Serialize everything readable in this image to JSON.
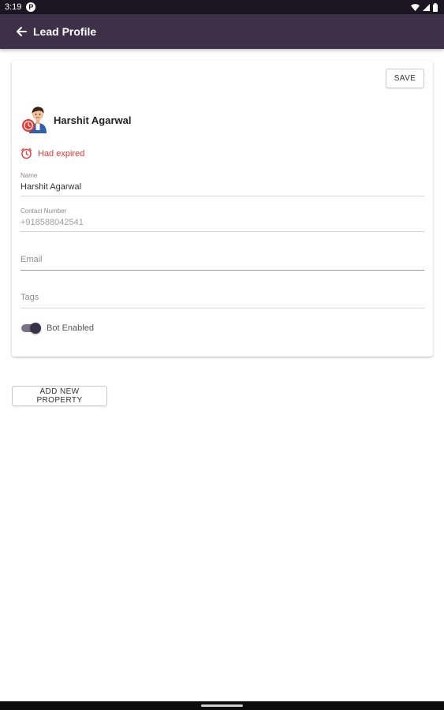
{
  "status_bar": {
    "time": "3:19",
    "app_icon_letter": "P",
    "icons": [
      "wifi-icon",
      "signal-icon",
      "battery-icon"
    ]
  },
  "app_bar": {
    "title": "Lead Profile",
    "back_icon": "arrow-left-icon",
    "background_color": "#3d3048"
  },
  "card": {
    "save_label": "SAVE",
    "profile": {
      "name": "Harshit Agarwal",
      "avatar_icon": "avatar-cartoon-with-clock-badge"
    },
    "status": {
      "text": "Had expired",
      "icon": "alarm-clock-icon",
      "color": "#e53935"
    },
    "fields": {
      "name": {
        "label": "Name",
        "value": "Harshit Agarwal"
      },
      "contact": {
        "label": "Contact Number",
        "value": "+918588042541"
      },
      "email": {
        "placeholder": "Email",
        "value": ""
      },
      "tags": {
        "placeholder": "Tags",
        "value": ""
      }
    },
    "bot_toggle": {
      "label": "Bot Enabled",
      "enabled": true
    }
  },
  "add_property_label": "ADD NEW PROPERTY"
}
